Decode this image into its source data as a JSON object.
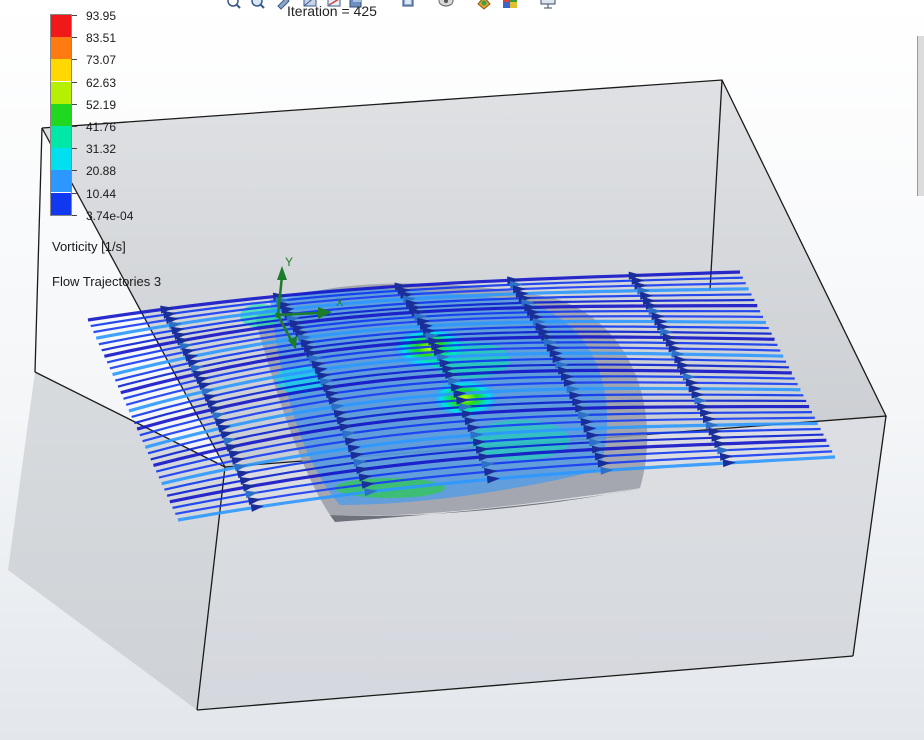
{
  "iteration_text": "Iteration = 425",
  "legend": {
    "values": [
      "93.95",
      "83.51",
      "73.07",
      "62.63",
      "52.19",
      "41.76",
      "31.32",
      "20.88",
      "10.44",
      "3.74e-04"
    ],
    "colors": [
      "#f01818",
      "#ff7a10",
      "#ffd800",
      "#b6f000",
      "#20d820",
      "#00e8a8",
      "#00e0f0",
      "#2c98ff",
      "#1038f0",
      "#1414c8"
    ]
  },
  "parameter_label": "Vorticity [1/s]",
  "plot_name": "Flow Trajectories 3",
  "axis_labels": {
    "y": "Y",
    "x": "X"
  },
  "toolbar": {
    "icons": [
      "zoom-to-fit-icon",
      "zoom-area-icon",
      "previous-view-icon",
      "section-view-icon",
      "view-orientation-icon",
      "display-style-icon",
      "hide-show-icon",
      "edit-appearance-icon",
      "apply-scene-icon",
      "view-settings-icon"
    ]
  },
  "colors": {
    "box_edge": "#1a1a1a",
    "box_fill": "#b9bcc1",
    "airfoil": "#9a9ea6"
  }
}
